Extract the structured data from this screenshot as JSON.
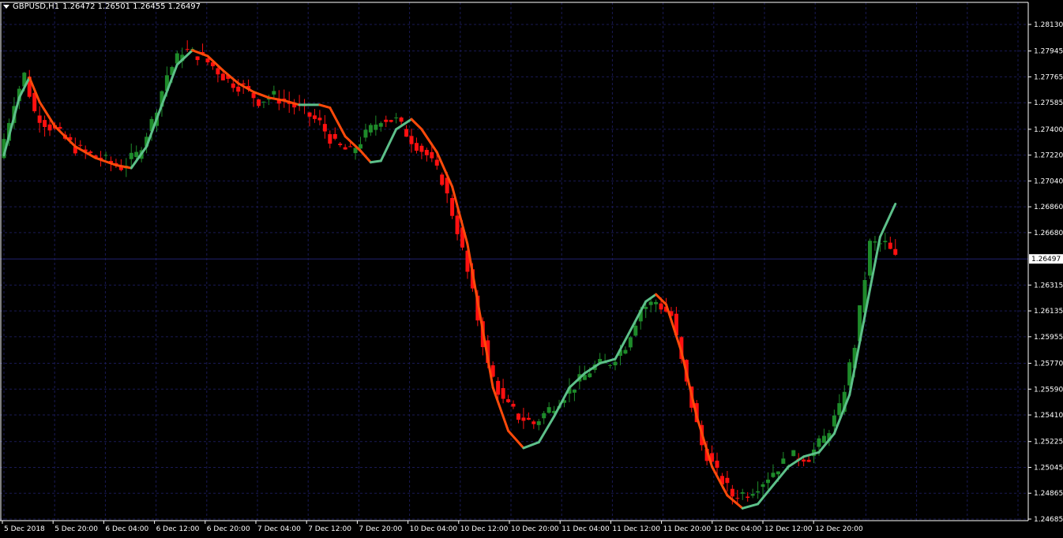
{
  "header": {
    "symbol": "GBPUSD,H1",
    "quote": "1.26472 1.26501 1.26455 1.26497"
  },
  "colors": {
    "bg": "#000000",
    "grid": "#1a1a55",
    "axis": "#ffffff",
    "bull": "#1e8b2a",
    "bear": "#ff1010",
    "ma_up": "#5dc08a",
    "ma_down": "#ff4a0a",
    "price_line": "#20206e"
  },
  "chart_data": {
    "type": "candlestick",
    "title": "",
    "y_ticks": [
      1.2813,
      1.27945,
      1.27765,
      1.27585,
      1.274,
      1.2722,
      1.2704,
      1.2686,
      1.2668,
      1.26315,
      1.26135,
      1.25955,
      1.2577,
      1.2559,
      1.2541,
      1.25225,
      1.25045,
      1.24865,
      1.24685
    ],
    "ylim": [
      1.24685,
      1.2813
    ],
    "x_ticks": [
      "5 Dec 2018",
      "5 Dec 20:00",
      "6 Dec 04:00",
      "6 Dec 12:00",
      "6 Dec 20:00",
      "7 Dec 04:00",
      "7 Dec 12:00",
      "7 Dec 20:00",
      "10 Dec 04:00",
      "10 Dec 12:00",
      "10 Dec 20:00",
      "11 Dec 04:00",
      "11 Dec 12:00",
      "11 Dec 20:00",
      "12 Dec 04:00",
      "12 Dec 12:00",
      "12 Dec 20:00"
    ],
    "current_price": 1.26497,
    "current_price_label": "1.26497",
    "price_path": [
      [
        0,
        1.272
      ],
      [
        3,
        1.276
      ],
      [
        5,
        1.2778
      ],
      [
        7,
        1.2752
      ],
      [
        9,
        1.2745
      ],
      [
        12,
        1.2736
      ],
      [
        15,
        1.2727
      ],
      [
        18,
        1.2722
      ],
      [
        21,
        1.2718
      ],
      [
        24,
        1.2714
      ],
      [
        27,
        1.2722
      ],
      [
        30,
        1.2745
      ],
      [
        33,
        1.2778
      ],
      [
        36,
        1.2795
      ],
      [
        39,
        1.2792
      ],
      [
        42,
        1.2784
      ],
      [
        45,
        1.2774
      ],
      [
        48,
        1.2769
      ],
      [
        51,
        1.276
      ],
      [
        54,
        1.2763
      ],
      [
        57,
        1.2758
      ],
      [
        60,
        1.2752
      ],
      [
        63,
        1.2744
      ],
      [
        66,
        1.2729
      ],
      [
        69,
        1.2724
      ],
      [
        72,
        1.2736
      ],
      [
        75,
        1.2748
      ],
      [
        78,
        1.2746
      ],
      [
        81,
        1.2733
      ],
      [
        84,
        1.2722
      ],
      [
        87,
        1.2705
      ],
      [
        90,
        1.267
      ],
      [
        93,
        1.2625
      ],
      [
        96,
        1.2575
      ],
      [
        99,
        1.255
      ],
      [
        102,
        1.254
      ],
      [
        105,
        1.2535
      ],
      [
        108,
        1.2545
      ],
      [
        111,
        1.2555
      ],
      [
        114,
        1.2565
      ],
      [
        117,
        1.2575
      ],
      [
        120,
        1.2578
      ],
      [
        123,
        1.259
      ],
      [
        126,
        1.2615
      ],
      [
        129,
        1.262
      ],
      [
        132,
        1.261
      ],
      [
        135,
        1.2562
      ],
      [
        138,
        1.252
      ],
      [
        141,
        1.25
      ],
      [
        144,
        1.2485
      ],
      [
        147,
        1.2487
      ],
      [
        150,
        1.2495
      ],
      [
        153,
        1.2505
      ],
      [
        156,
        1.2512
      ],
      [
        159,
        1.2512
      ],
      [
        162,
        1.2525
      ],
      [
        165,
        1.2545
      ],
      [
        168,
        1.259
      ],
      [
        171,
        1.266
      ],
      [
        174,
        1.266
      ],
      [
        176,
        1.265
      ]
    ],
    "ma_path": [
      [
        0,
        1.2722
      ],
      [
        3,
        1.2762
      ],
      [
        5,
        1.2776
      ],
      [
        7,
        1.2759
      ],
      [
        10,
        1.2742
      ],
      [
        14,
        1.2728
      ],
      [
        18,
        1.272
      ],
      [
        22,
        1.2715
      ],
      [
        25,
        1.2713
      ],
      [
        28,
        1.2728
      ],
      [
        31,
        1.2757
      ],
      [
        34,
        1.2785
      ],
      [
        37,
        1.2795
      ],
      [
        40,
        1.2791
      ],
      [
        43,
        1.2781
      ],
      [
        46,
        1.2772
      ],
      [
        49,
        1.2766
      ],
      [
        52,
        1.2762
      ],
      [
        55,
        1.276
      ],
      [
        58,
        1.2757
      ],
      [
        62,
        1.2757
      ],
      [
        64,
        1.2755
      ],
      [
        67,
        1.2735
      ],
      [
        70,
        1.2725
      ],
      [
        72,
        1.2717
      ],
      [
        74,
        1.2718
      ],
      [
        77,
        1.274
      ],
      [
        80,
        1.2747
      ],
      [
        82,
        1.274
      ],
      [
        85,
        1.2724
      ],
      [
        88,
        1.27
      ],
      [
        91,
        1.266
      ],
      [
        94,
        1.26
      ],
      [
        96,
        1.256
      ],
      [
        99,
        1.253
      ],
      [
        102,
        1.2518
      ],
      [
        105,
        1.2522
      ],
      [
        108,
        1.254
      ],
      [
        111,
        1.256
      ],
      [
        114,
        1.257
      ],
      [
        117,
        1.2577
      ],
      [
        120,
        1.258
      ],
      [
        123,
        1.26
      ],
      [
        126,
        1.262
      ],
      [
        128,
        1.2625
      ],
      [
        130,
        1.2618
      ],
      [
        133,
        1.2585
      ],
      [
        136,
        1.254
      ],
      [
        139,
        1.2505
      ],
      [
        142,
        1.2485
      ],
      [
        145,
        1.2476
      ],
      [
        148,
        1.2479
      ],
      [
        151,
        1.2492
      ],
      [
        154,
        1.2505
      ],
      [
        157,
        1.2512
      ],
      [
        160,
        1.2515
      ],
      [
        163,
        1.2528
      ],
      [
        166,
        1.2555
      ],
      [
        169,
        1.261
      ],
      [
        172,
        1.2665
      ],
      [
        175,
        1.2688
      ]
    ]
  }
}
